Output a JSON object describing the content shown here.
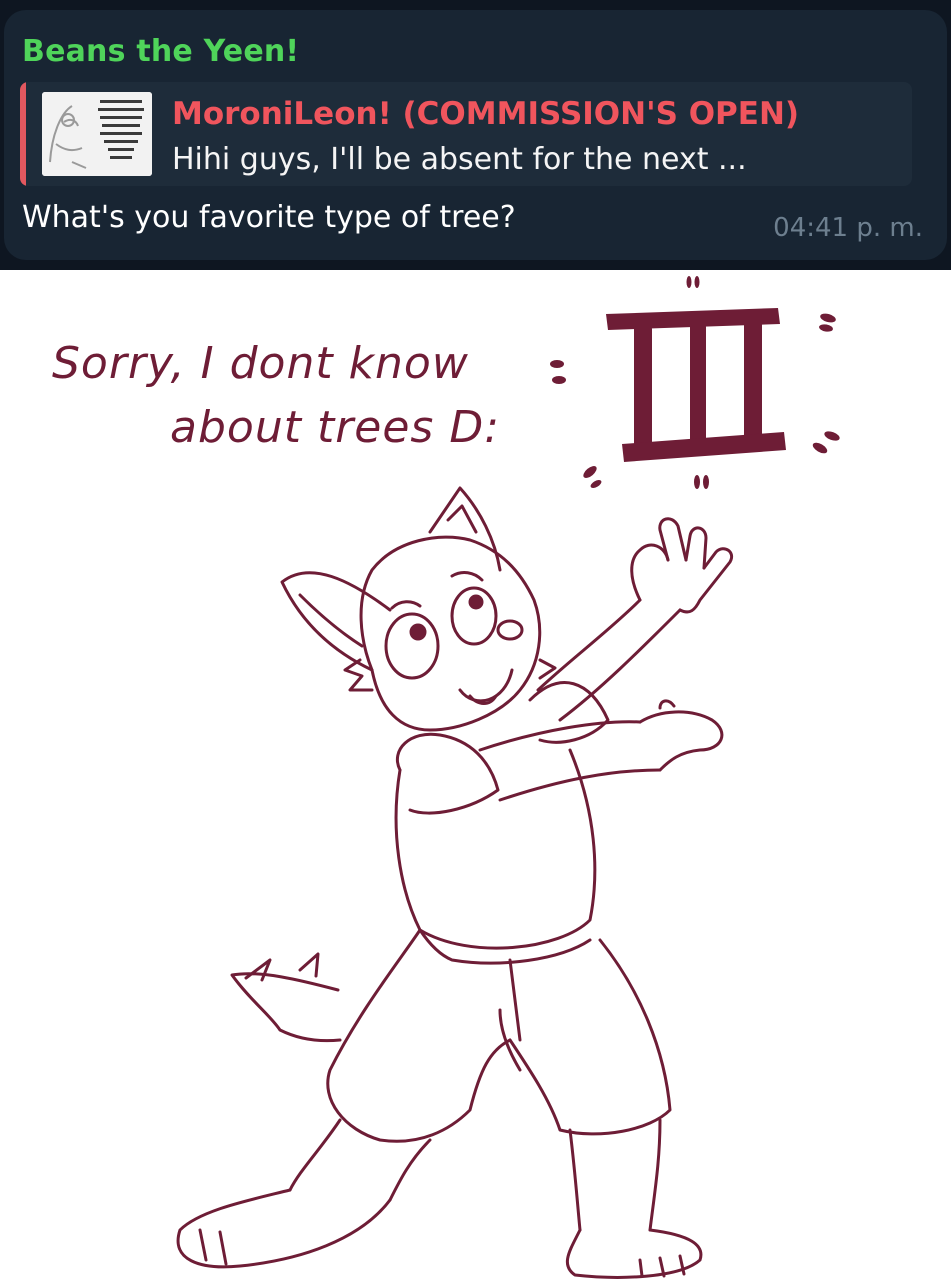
{
  "chat": {
    "sender_name": "Beans the Yeen!",
    "reply": {
      "author": "MoroniLeon! (COMMISSION'S OPEN)",
      "preview": "Hihi guys, I'll be absent for the next ..."
    },
    "message": "What's you favorite type of tree?",
    "time": "04:41 p. m.",
    "colors": {
      "background": "#0e1621",
      "bubble": "#182533",
      "sender": "#4fd45a",
      "reply_author": "#f0555d",
      "time": "#6d7f8f"
    }
  },
  "drawing": {
    "caption_line1": "Sorry, I dont know",
    "caption_line2": "about trees D:",
    "ink_color": "#6e1d36",
    "subject": "cartoon furry character waving beneath a tree-shaped symbol"
  }
}
